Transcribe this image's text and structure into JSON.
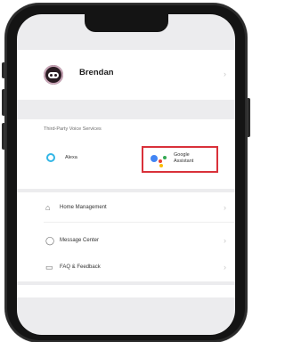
{
  "profile": {
    "name": "Brendan"
  },
  "third_party": {
    "title": "Third-Party Voice Services",
    "alexa_label": "Alexa",
    "google_label_line1": "Google",
    "google_label_line2": "Assistant",
    "highlight_color": "#d9313a"
  },
  "menu": {
    "items": [
      {
        "label": "Home Management",
        "icon": "home-icon"
      },
      {
        "label": "Message Center",
        "icon": "message-icon"
      },
      {
        "label": "FAQ & Feedback",
        "icon": "faq-icon"
      }
    ]
  },
  "colors": {
    "alexa": "#33b6e6",
    "google_blue": "#4285f4",
    "google_red": "#ea4335",
    "google_yellow": "#fbbc05",
    "google_green": "#34a853"
  }
}
